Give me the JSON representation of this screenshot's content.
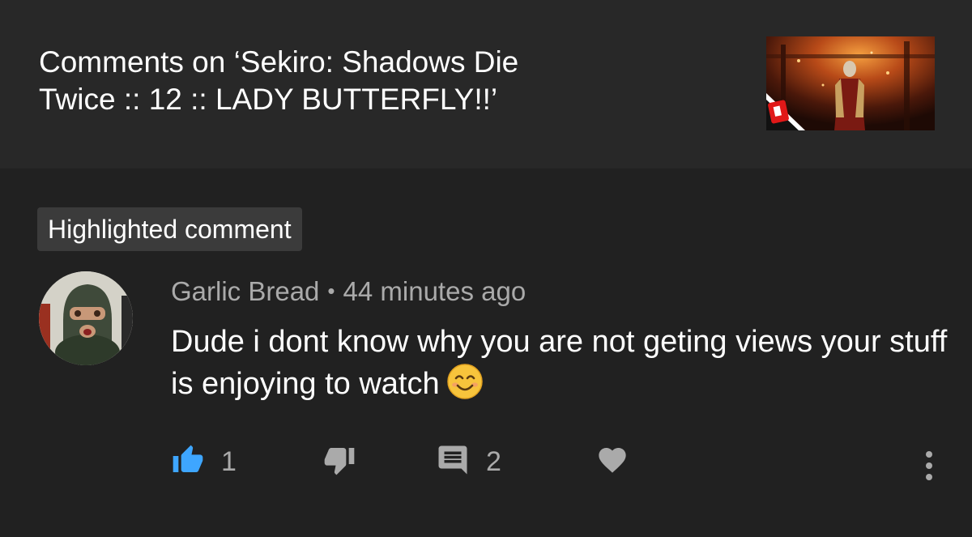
{
  "header": {
    "title": "Comments on ‘Sekiro: Shadows Die\nTwice :: 12 :: LADY BUTTERFLY!!’",
    "thumbnail": "video-thumbnail"
  },
  "comment": {
    "badge": "Highlighted comment",
    "author": "Garlic Bread",
    "separator": "•",
    "time": "44 minutes ago",
    "text": "Dude i dont know why you are not geting views your stuff is enjoying to watch",
    "emoji": "smiling-face-emoji"
  },
  "actions": {
    "like_count": "1",
    "reply_count": "2",
    "like_icon": "thumbs-up-icon",
    "dislike_icon": "thumbs-down-icon",
    "reply_icon": "comment-icon",
    "heart_icon": "heart-icon",
    "more_icon": "more-vert-icon"
  },
  "colors": {
    "background": "#212121",
    "header_background": "#282828",
    "badge_background": "#3b3b3b",
    "like_active": "#3ea6ff",
    "icon_muted": "#aaaaaa"
  }
}
